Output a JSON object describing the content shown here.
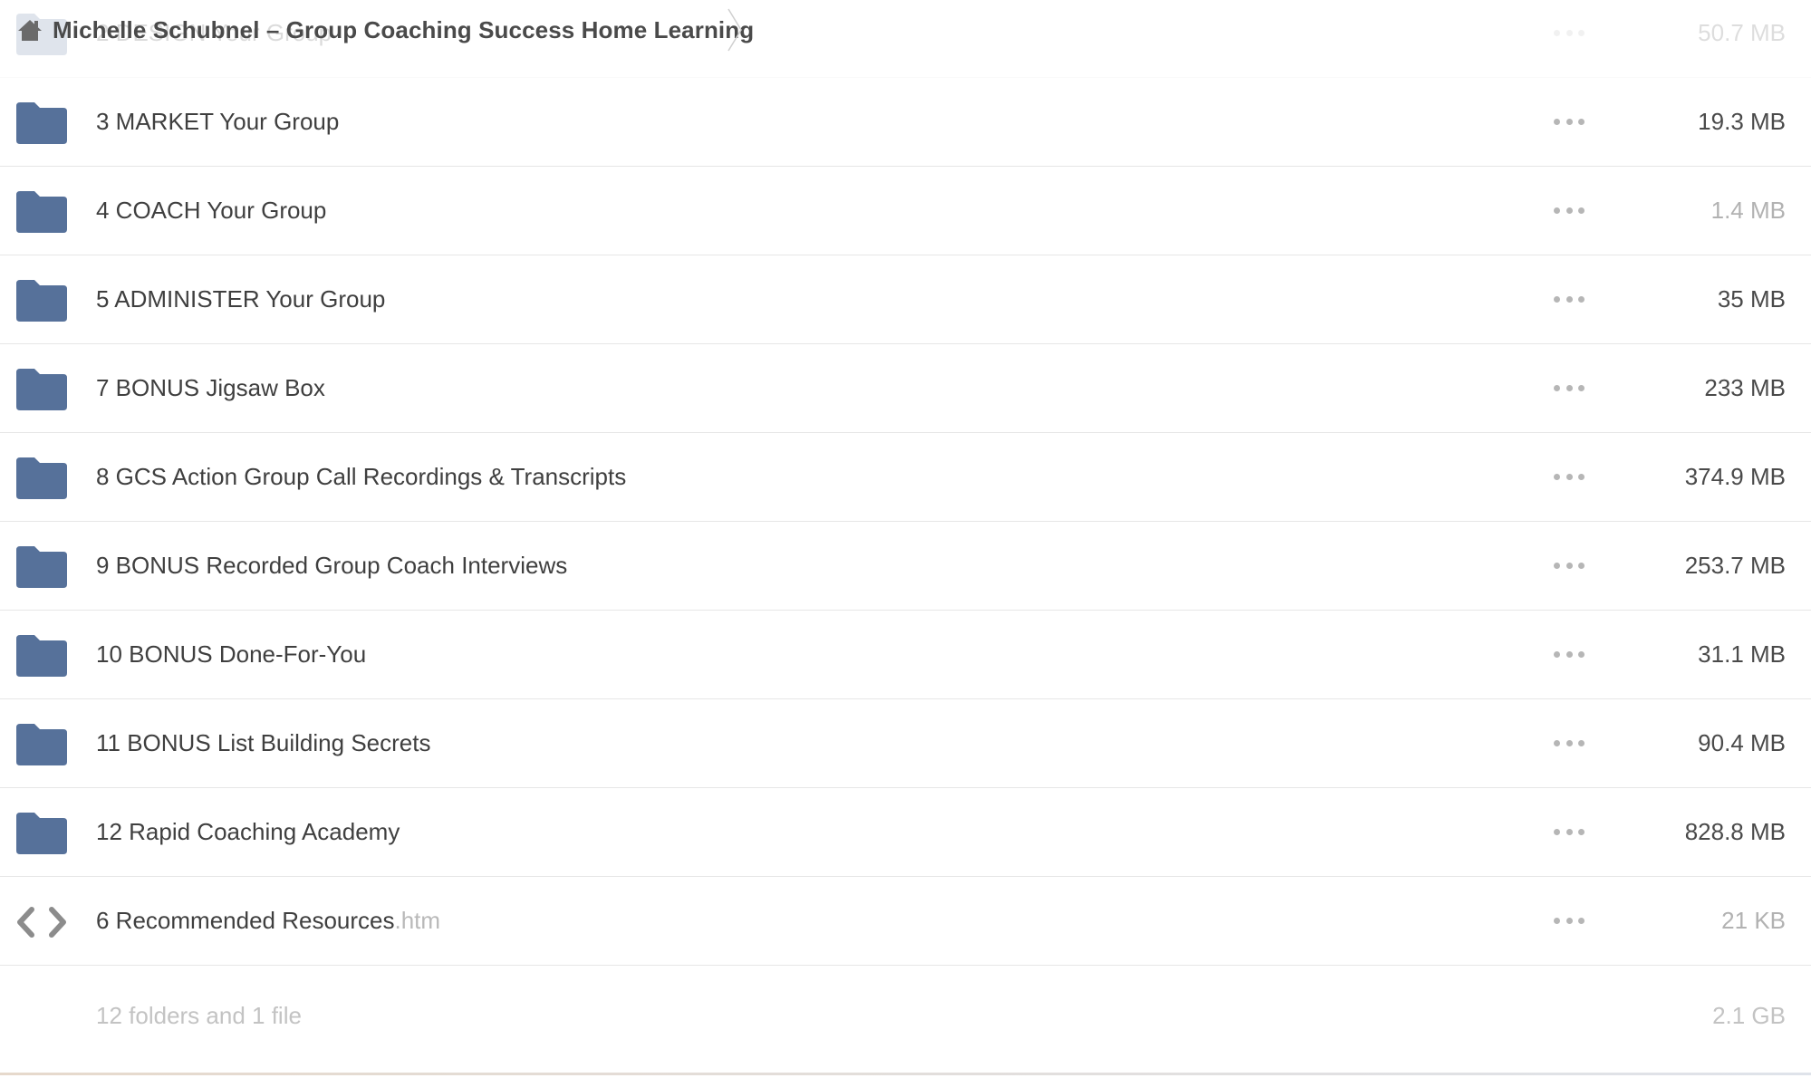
{
  "breadcrumb": {
    "title": "Michelle Schubnel – Group Coaching Success Home Learning"
  },
  "ghost_row": {
    "name": "2 DESIGN Your Group",
    "size": "50.7 MB"
  },
  "rows": [
    {
      "name": "3 MARKET Your Group",
      "ext": "",
      "size": "19.3 MB",
      "icon": "folder-icon",
      "muted": false
    },
    {
      "name": "4 COACH Your Group",
      "ext": "",
      "size": "1.4 MB",
      "icon": "folder-icon",
      "muted": true
    },
    {
      "name": "5 ADMINISTER Your Group",
      "ext": "",
      "size": "35 MB",
      "icon": "folder-icon",
      "muted": false
    },
    {
      "name": "7 BONUS Jigsaw Box",
      "ext": "",
      "size": "233 MB",
      "icon": "folder-icon",
      "muted": false
    },
    {
      "name": "8 GCS Action Group Call Recordings & Transcripts",
      "ext": "",
      "size": "374.9 MB",
      "icon": "folder-icon",
      "muted": false
    },
    {
      "name": "9 BONUS Recorded Group Coach Interviews",
      "ext": "",
      "size": "253.7 MB",
      "icon": "folder-icon",
      "muted": false
    },
    {
      "name": "10 BONUS Done-For-You",
      "ext": "",
      "size": "31.1 MB",
      "icon": "folder-icon",
      "muted": false
    },
    {
      "name": "11 BONUS List Building Secrets",
      "ext": "",
      "size": "90.4 MB",
      "icon": "folder-icon",
      "muted": false
    },
    {
      "name": "12 Rapid Coaching Academy",
      "ext": "",
      "size": "828.8 MB",
      "icon": "folder-icon",
      "muted": false
    },
    {
      "name": "6 Recommended Resources",
      "ext": ".htm",
      "size": "21 KB",
      "icon": "code-file-icon",
      "muted": true
    }
  ],
  "summary": {
    "text": "12 folders and 1 file",
    "size": "2.1 GB"
  },
  "colors": {
    "folder": "#56719a",
    "text": "#3f3f3f",
    "muted": "#b2b2b2",
    "code_icon": "#8c8c8c"
  }
}
